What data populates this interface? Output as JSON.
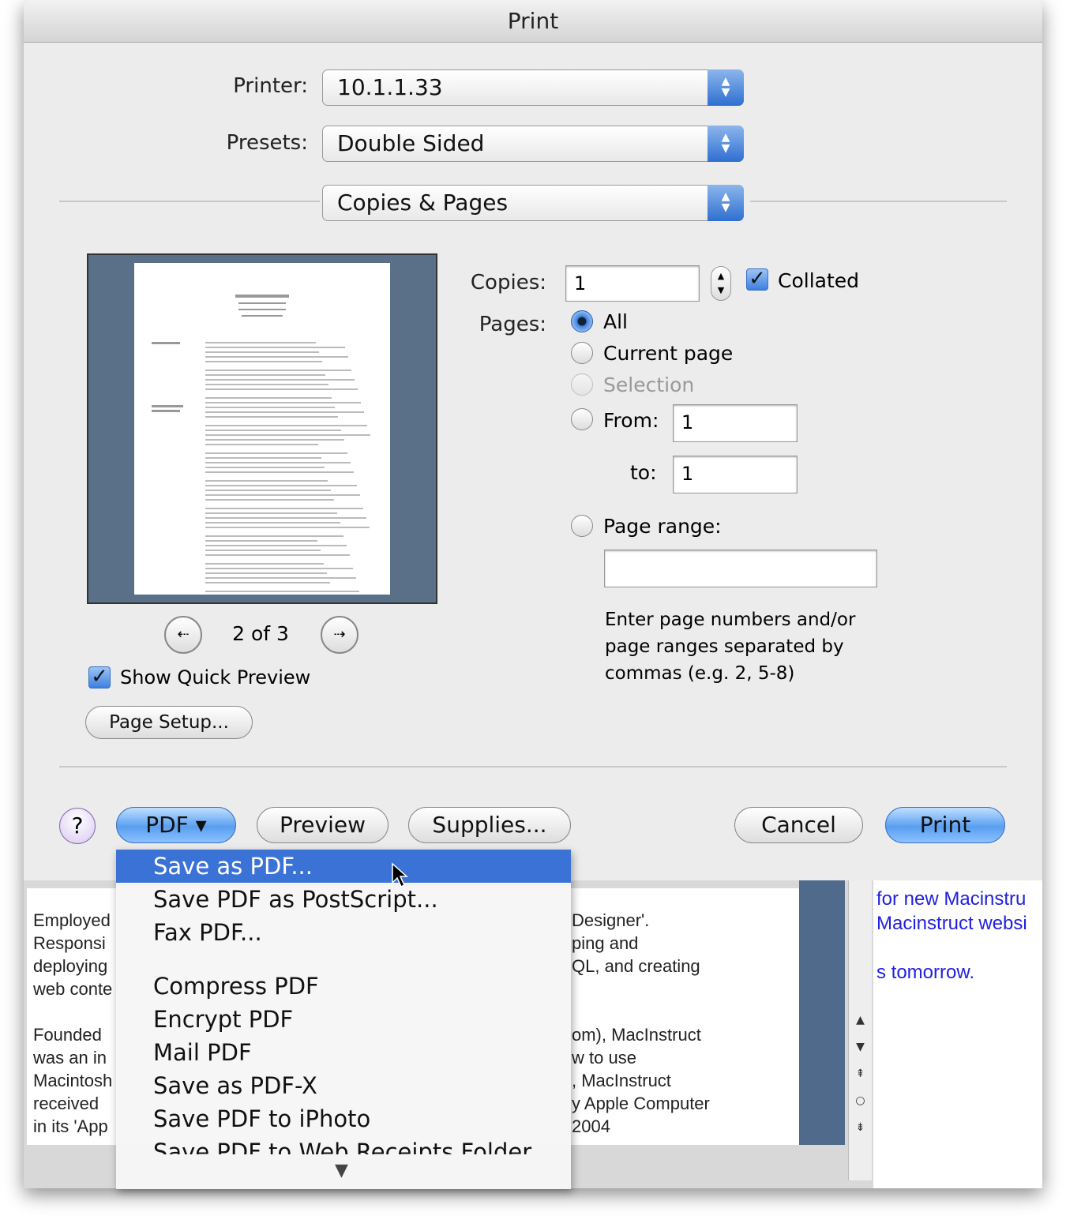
{
  "window": {
    "title": "Print"
  },
  "printer": {
    "label": "Printer:",
    "value": "10.1.1.33"
  },
  "presets": {
    "label": "Presets:",
    "value": "Double Sided"
  },
  "panel": {
    "value": "Copies & Pages"
  },
  "preview": {
    "page_indicator": "2 of 3",
    "show_quick_preview": "Show Quick Preview",
    "show_quick_preview_checked": true,
    "page_setup": "Page Setup..."
  },
  "copies": {
    "label": "Copies:",
    "value": "1",
    "collated_label": "Collated",
    "collated_checked": true
  },
  "pages": {
    "label": "Pages:",
    "all": "All",
    "current": "Current page",
    "selection": "Selection",
    "from_label": "From:",
    "from_value": "1",
    "to_label": "to:",
    "to_value": "1",
    "range_label": "Page range:",
    "range_value": "",
    "selected": "All",
    "hint": "Enter page numbers and/or page ranges separated by commas (e.g. 2, 5-8)"
  },
  "buttons": {
    "help": "?",
    "pdf": "PDF ▾",
    "preview": "Preview",
    "supplies": "Supplies...",
    "cancel": "Cancel",
    "print": "Print"
  },
  "pdf_menu": {
    "items": [
      "Save as PDF...",
      "Save PDF as PostScript...",
      "Fax PDF...",
      "Compress PDF",
      "Encrypt PDF",
      "Mail PDF",
      "Save as PDF-X",
      "Save PDF to iPhoto",
      "Save PDF to Web Receipts Folder"
    ],
    "selected": "Save as PDF..."
  },
  "background_doc": {
    "left_lines": [
      "Employed",
      "Responsi",
      "deploying",
      "web conte",
      "",
      "Founded",
      "was an in",
      "Macintosh",
      "received",
      "in its 'App"
    ],
    "right_lines": [
      "Designer'.",
      "ping and",
      "QL, and creating",
      "",
      "",
      "om), MacInstruct",
      "w to use",
      ", MacInstruct",
      "y Apple Computer",
      "2004"
    ],
    "side_lines": [
      "for new Macinstru",
      "Macinstruct websi",
      "s tomorrow."
    ]
  },
  "colors": {
    "accent": "#3a72d6",
    "dialog_bg": "#ececec",
    "preview_bg": "#5a6f88"
  }
}
